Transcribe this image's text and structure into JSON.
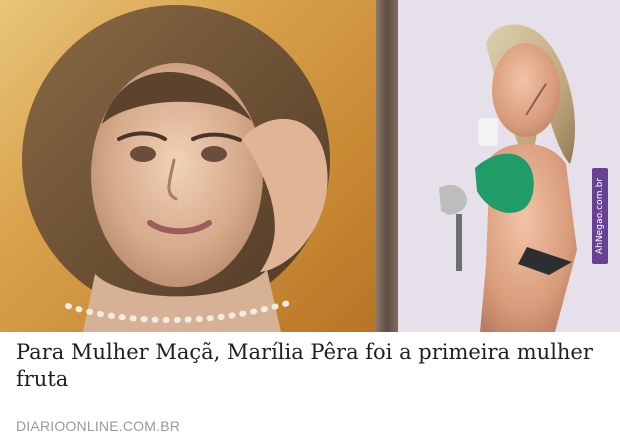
{
  "watermark": {
    "text": "AhNegao.com.br"
  },
  "caption": {
    "headline": "Para Mulher Maçã, Marília Pêra foi a primeira mulher fruta"
  },
  "source": {
    "text": "DIARIOONLINE.COM.BR"
  },
  "colors": {
    "watermark_bg": "#60388f",
    "headline_text": "#1f1f1f",
    "source_text": "#9a9a9a"
  }
}
